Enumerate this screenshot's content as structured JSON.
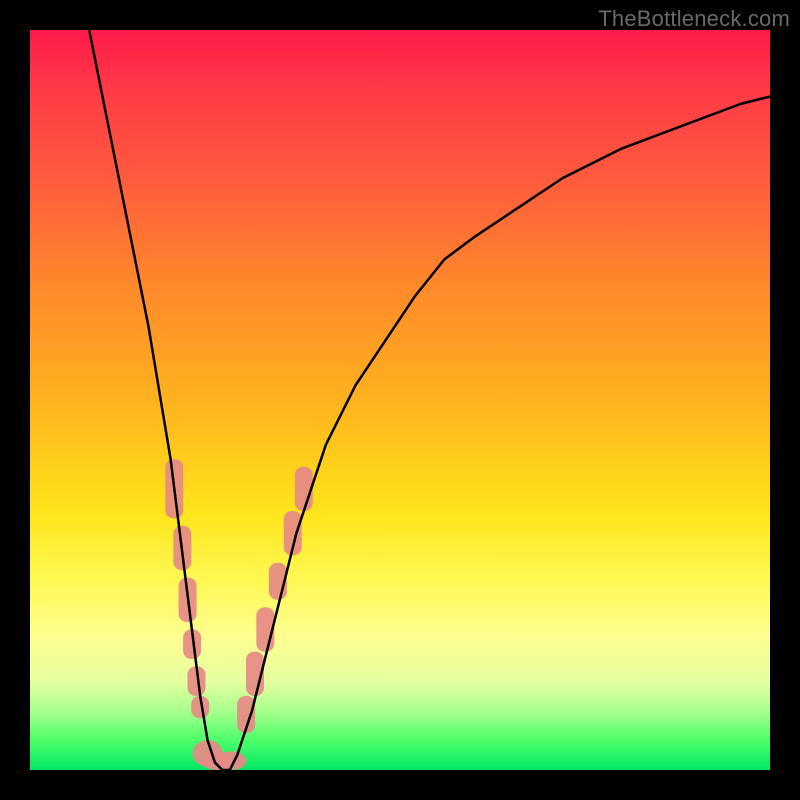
{
  "watermark": "TheBottleneck.com",
  "colors": {
    "frame": "#000000",
    "curve_stroke": "#000000",
    "band_fill": "#e68a86",
    "gradient_top": "#ff1a4a",
    "gradient_bottom": "#00e765"
  },
  "chart_data": {
    "type": "line",
    "title": "",
    "xlabel": "",
    "ylabel": "",
    "xlim": [
      0,
      100
    ],
    "ylim": [
      0,
      100
    ],
    "legend": false,
    "grid": false,
    "series": [
      {
        "name": "bottleneck-curve",
        "x": [
          8,
          10,
          12,
          14,
          16,
          18,
          19,
          20,
          21,
          22,
          23,
          24,
          25,
          26,
          27,
          28,
          30,
          32,
          34,
          36,
          38,
          40,
          44,
          48,
          52,
          56,
          60,
          66,
          72,
          80,
          88,
          96,
          100
        ],
        "y": [
          100,
          90,
          80,
          70,
          60,
          48,
          42,
          34,
          26,
          18,
          10,
          4,
          1,
          0,
          0,
          2,
          8,
          16,
          24,
          32,
          38,
          44,
          52,
          58,
          64,
          69,
          72,
          76,
          80,
          84,
          87,
          90,
          91
        ]
      }
    ],
    "annotations": {
      "salmon_bands": {
        "note": "approximate x,y extents of salmon rounded-rect markers overlaid along curve near trough",
        "left_branch": [
          {
            "x": 19.5,
            "y_top": 42,
            "y_bot": 34
          },
          {
            "x": 20.6,
            "y_top": 33,
            "y_bot": 27
          },
          {
            "x": 21.3,
            "y_top": 26,
            "y_bot": 20
          },
          {
            "x": 21.9,
            "y_top": 19,
            "y_bot": 15
          },
          {
            "x": 22.5,
            "y_top": 14,
            "y_bot": 10
          },
          {
            "x": 23.0,
            "y_top": 10,
            "y_bot": 7
          }
        ],
        "trough": [
          {
            "x": 24.0,
            "y_top": 4,
            "y_bot": 0.5
          },
          {
            "x": 25.2,
            "y_top": 2.5,
            "y_bot": 0
          },
          {
            "x": 27.2,
            "y_top": 2.5,
            "y_bot": 0
          }
        ],
        "right_branch": [
          {
            "x": 29.2,
            "y_top": 10,
            "y_bot": 5
          },
          {
            "x": 30.4,
            "y_top": 16,
            "y_bot": 10
          },
          {
            "x": 31.8,
            "y_top": 22,
            "y_bot": 16
          },
          {
            "x": 33.5,
            "y_top": 28,
            "y_bot": 23
          },
          {
            "x": 35.5,
            "y_top": 35,
            "y_bot": 29
          },
          {
            "x": 37.0,
            "y_top": 41,
            "y_bot": 35
          }
        ]
      }
    }
  }
}
